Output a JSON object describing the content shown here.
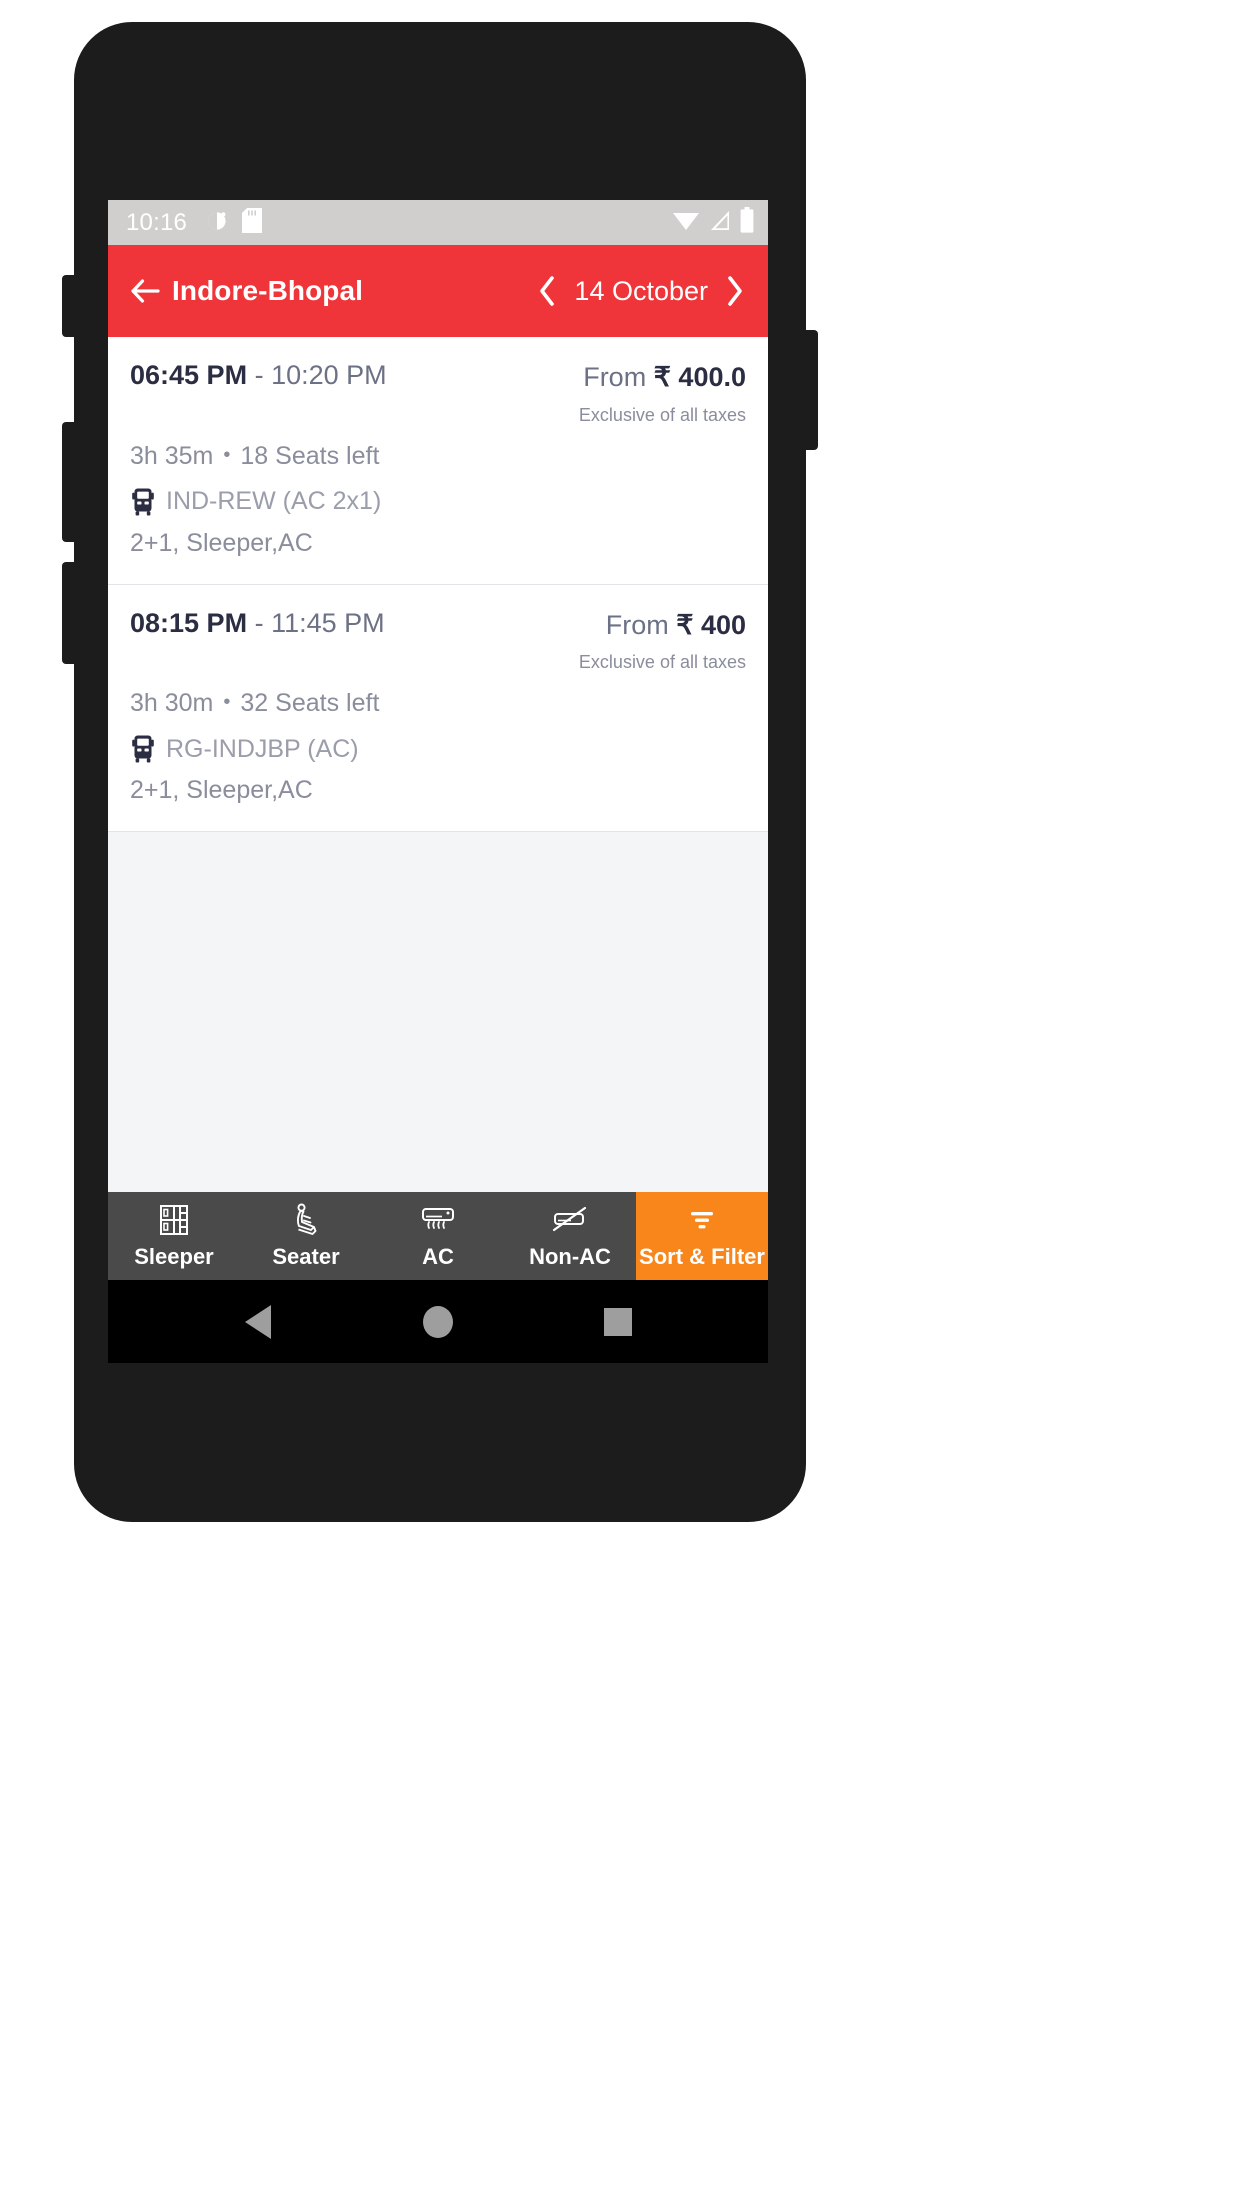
{
  "status_bar": {
    "time": "10:16",
    "left_icons": [
      "alarm-icon",
      "sd-card-icon"
    ],
    "right_icons": [
      "wifi-icon",
      "cellular-signal-icon",
      "battery-icon"
    ],
    "background": "#d0cfce"
  },
  "app_bar": {
    "back_icon": "back-arrow-icon",
    "title": "Indore-Bhopal",
    "prev_icon": "chevron-left-icon",
    "date": "14 October",
    "next_icon": "chevron-right-icon",
    "background": "#ef3539"
  },
  "results": [
    {
      "departure": "06:45 PM",
      "separator": "-",
      "arrival": "10:20 PM",
      "duration": "3h 35m",
      "bullet": "•",
      "seats": "18 Seats left",
      "bus_icon": "bus-icon",
      "bus_name": "IND-REW (AC 2x1)",
      "layout": "2+1, Sleeper,AC",
      "price_prefix": "From",
      "currency": "₹",
      "price": "400.0",
      "taxes_note": "Exclusive of all taxes"
    },
    {
      "departure": "08:15 PM",
      "separator": "-",
      "arrival": "11:45 PM",
      "duration": "3h 30m",
      "bullet": "•",
      "seats": "32 Seats left",
      "bus_icon": "bus-icon",
      "bus_name": "RG-INDJBP (AC)",
      "layout": "2+1, Sleeper,AC",
      "price_prefix": "From",
      "currency": "₹",
      "price": "400",
      "taxes_note": "Exclusive of all taxes"
    }
  ],
  "filter_bar": {
    "background": "#4a4a4a",
    "accent": "#f8861a",
    "items": [
      {
        "label": "Sleeper",
        "icon": "sleeper-berth-icon",
        "active": false
      },
      {
        "label": "Seater",
        "icon": "seat-icon",
        "active": false
      },
      {
        "label": "AC",
        "icon": "air-conditioner-icon",
        "active": false
      },
      {
        "label": "Non-AC",
        "icon": "air-conditioner-off-icon",
        "active": false
      },
      {
        "label": "Sort & Filter",
        "icon": "filter-icon",
        "active": true
      }
    ]
  },
  "nav_bar": {
    "back": "android-back-icon",
    "home": "android-home-icon",
    "recents": "android-recents-icon"
  }
}
